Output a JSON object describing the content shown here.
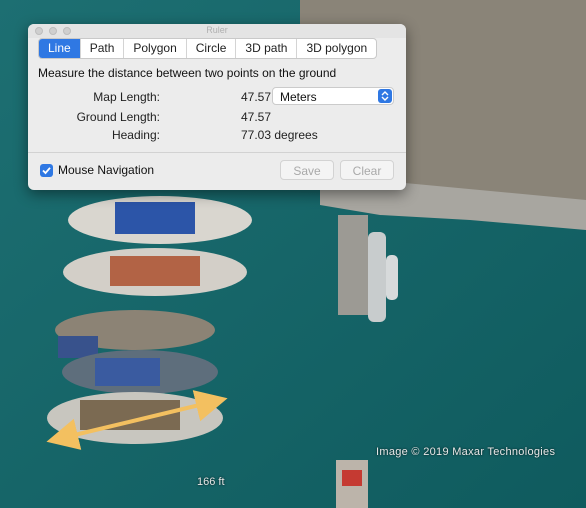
{
  "window": {
    "title": "Ruler"
  },
  "tabs": [
    {
      "label": "Line",
      "active": true
    },
    {
      "label": "Path",
      "active": false
    },
    {
      "label": "Polygon",
      "active": false
    },
    {
      "label": "Circle",
      "active": false
    },
    {
      "label": "3D path",
      "active": false
    },
    {
      "label": "3D polygon",
      "active": false
    }
  ],
  "instruction": "Measure the distance between two points on the ground",
  "measurements": {
    "map_length_label": "Map Length:",
    "map_length_value": "47.57",
    "unit": "Meters",
    "ground_length_label": "Ground Length:",
    "ground_length_value": "47.57",
    "heading_label": "Heading:",
    "heading_value": "77.03 degrees"
  },
  "mouse_navigation": {
    "label": "Mouse Navigation",
    "checked": true
  },
  "buttons": {
    "save": "Save",
    "clear": "Clear"
  },
  "map": {
    "attribution": "Image © 2019 Maxar Technologies",
    "scale_label": "166 ft",
    "measure_line_color": "#f3c060"
  },
  "colors": {
    "accent": "#2f78e3"
  }
}
